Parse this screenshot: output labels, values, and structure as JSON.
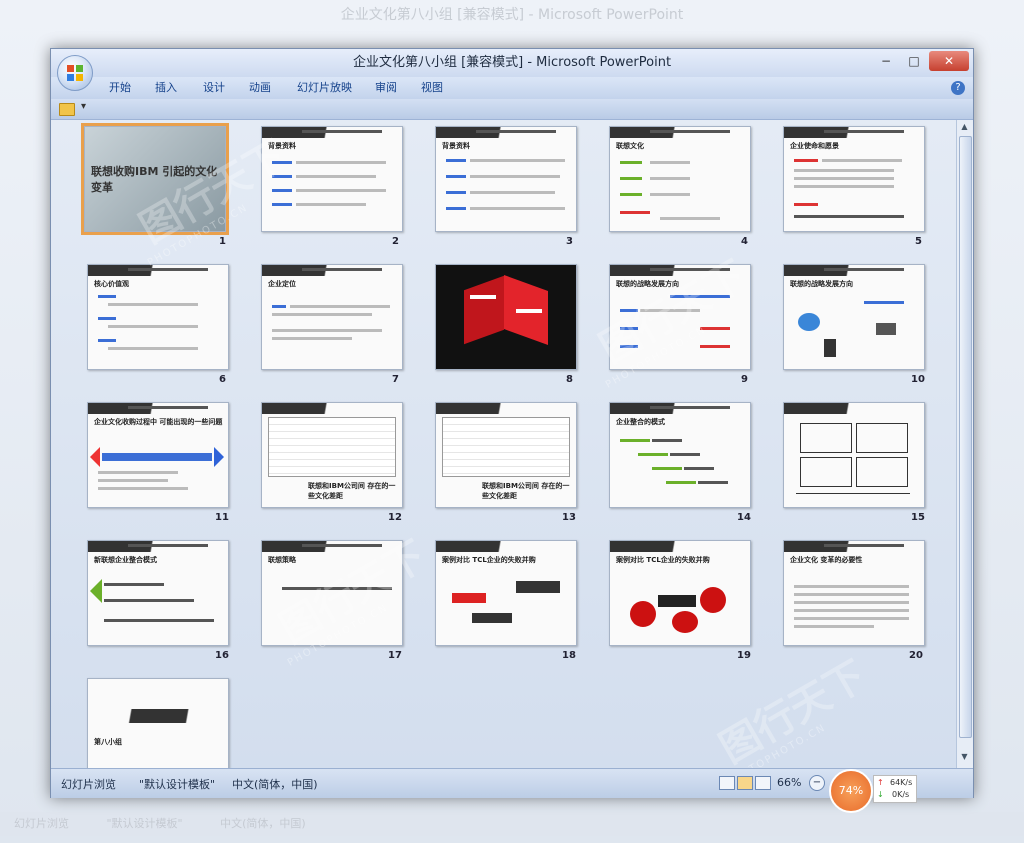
{
  "background": {
    "title": "企业文化第八小组 [兼容模式] - Microsoft PowerPoint",
    "menu": [
      "开始",
      "插入",
      "设计",
      "动画",
      "幻灯片放映",
      "审阅",
      "视图"
    ],
    "status": [
      "幻灯片浏览",
      "\"默认设计模板\"",
      "中文(简体，中国)"
    ],
    "net_up": "64K/s",
    "net_down": "0K/s"
  },
  "window": {
    "title": "企业文化第八小组 [兼容模式] - Microsoft PowerPoint",
    "minimize": "−",
    "maximize": "□",
    "close": "✕"
  },
  "ribbon": {
    "tabs": [
      "开始",
      "插入",
      "设计",
      "动画",
      "幻灯片放映",
      "审阅",
      "视图"
    ],
    "help": "?"
  },
  "qat": {
    "dropdown": "▾"
  },
  "slides": [
    {
      "num": "1",
      "title": "联想收购IBM  引起的文化变革"
    },
    {
      "num": "2",
      "title": "背景资料"
    },
    {
      "num": "3",
      "title": "背景资料"
    },
    {
      "num": "4",
      "title": "联想文化"
    },
    {
      "num": "5",
      "title": "企业使命和愿景"
    },
    {
      "num": "6",
      "title": "核心价值观"
    },
    {
      "num": "7",
      "title": "企业定位"
    },
    {
      "num": "8",
      "title": ""
    },
    {
      "num": "9",
      "title": "联想的战略发展方向"
    },
    {
      "num": "10",
      "title": "联想的战略发展方向"
    },
    {
      "num": "11",
      "title": "企业文化收购过程中 可能出现的一些问题"
    },
    {
      "num": "12",
      "title": "联想和IBM公司间 存在的一些文化差距"
    },
    {
      "num": "13",
      "title": "联想和IBM公司间 存在的一些文化差距"
    },
    {
      "num": "14",
      "title": "企业整合的模式"
    },
    {
      "num": "15",
      "title": ""
    },
    {
      "num": "16",
      "title": "新联想企业整合模式"
    },
    {
      "num": "17",
      "title": "联想策略"
    },
    {
      "num": "18",
      "title": "案例对比 TCL企业的失败并购"
    },
    {
      "num": "19",
      "title": "案例对比 TCL企业的失败并购"
    },
    {
      "num": "20",
      "title": "企业文化 变革的必要性"
    },
    {
      "num": "21",
      "title": "第八小组"
    }
  ],
  "statusbar": {
    "view": "幻灯片浏览",
    "theme": "\"默认设计模板\"",
    "lang": "中文(简体，中国)",
    "zoom": "66%",
    "zoom_out": "−",
    "cpu": "74%",
    "net_up": "64K/s",
    "net_down": "0K/s",
    "arrow_up": "↑",
    "arrow_down": "↓"
  },
  "scroll": {
    "up": "▲",
    "down": "▼"
  },
  "watermark": {
    "text": "图行天下",
    "sub": "PHOTOPHOTO.CN"
  }
}
